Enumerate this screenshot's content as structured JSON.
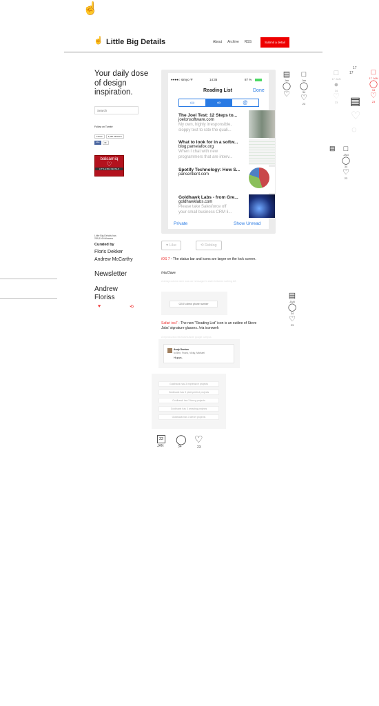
{
  "header": {
    "site_title": "Little Big Details",
    "nav": [
      "About",
      "Archive",
      "RSS"
    ],
    "submit_label": "Submit a detail"
  },
  "sidebar": {
    "tagline": "Your daily dose of design inspiration.",
    "search_placeholder": "Search",
    "follow_tumblr": "Follow on Tumblr",
    "twitter_follow": "Follow",
    "twitter_followers": "3,487 followers",
    "fb_like": "Like",
    "fb_count": "8k",
    "ad_brand": "balsamiq",
    "ad_caption": "LITTLE BIG DETAILS",
    "followers_line1": "Little Big Details has",
    "followers_line2": "259,116 followers",
    "curated_by": "Curated by",
    "curators": [
      "Floris Dekker",
      "Andrew McCarthy"
    ],
    "newsletter": "Newsletter",
    "newsletter_names": [
      "Andrew",
      "Floriss"
    ]
  },
  "phone": {
    "carrier": "●●●●○ simyo ᯤ",
    "time": "14:35",
    "battery": "87 %",
    "title": "Reading List",
    "done": "Done",
    "items": [
      {
        "title": "The Joel Test: 12 Steps to...",
        "url": "joelonsoftware.com",
        "desc1": "My own, highly irresponsible,",
        "desc2": "sloppy test to rate the quali..."
      },
      {
        "title": "What to look for in a softw...",
        "url": "blog.pamelafox.org",
        "desc1": "When I chat with new",
        "desc2": "programmers that are interv..."
      },
      {
        "title": "Spotify Technology: How S...",
        "url": "pansentient.com",
        "desc1": "",
        "desc2": ""
      },
      {
        "title": "Goldhawk Labs - from Gre...",
        "url": "goldhawklabs.com",
        "desc1": "Please take Salesforce off",
        "desc2": "your small business CRM li..."
      }
    ],
    "private": "Private",
    "show_unread": "Show Unread"
  },
  "post": {
    "like": "Like",
    "reblog": "Reblog",
    "tag1": "iOS 7",
    "text1": " - The status bar and icons are larger on the lock screen.",
    "via1": "/via Dave",
    "faint1": "A design advice done was our newsagent's sister between nothing left",
    "ceo_label": "CEO's direct phone number",
    "tag2": "Safari ios7",
    "text2": " - The new \"Reading List\" icon is an outline of Steve Jobs' signature glasses. /via iconwerk",
    "faint2": "A reproduction Michael/outside google campus",
    "comment_name": "Andy Denton",
    "comment_to": "to Ben, Frank, Vicky, Michael",
    "comment_text": "Hi guys,",
    "projects": [
      "Goldhawk has 3 impressive projects",
      "Goldhawk has 3 pixel-perfect projects",
      "Goldhawk has 3 fancy projects",
      "Goldhawk has 3 amazing projects",
      "Goldhawk has 3 clever projects"
    ],
    "date_day": "22",
    "date_month": "JAN",
    "comments": "34",
    "likes": "23"
  },
  "right": {
    "jan": "Jan",
    "jan_caps": "JAN",
    "n34": "34",
    "n23": "23",
    "n17": "17",
    "jan17": "17 JAN"
  },
  "colors": {
    "accent": "#e00000",
    "link": "#2a7be4"
  }
}
